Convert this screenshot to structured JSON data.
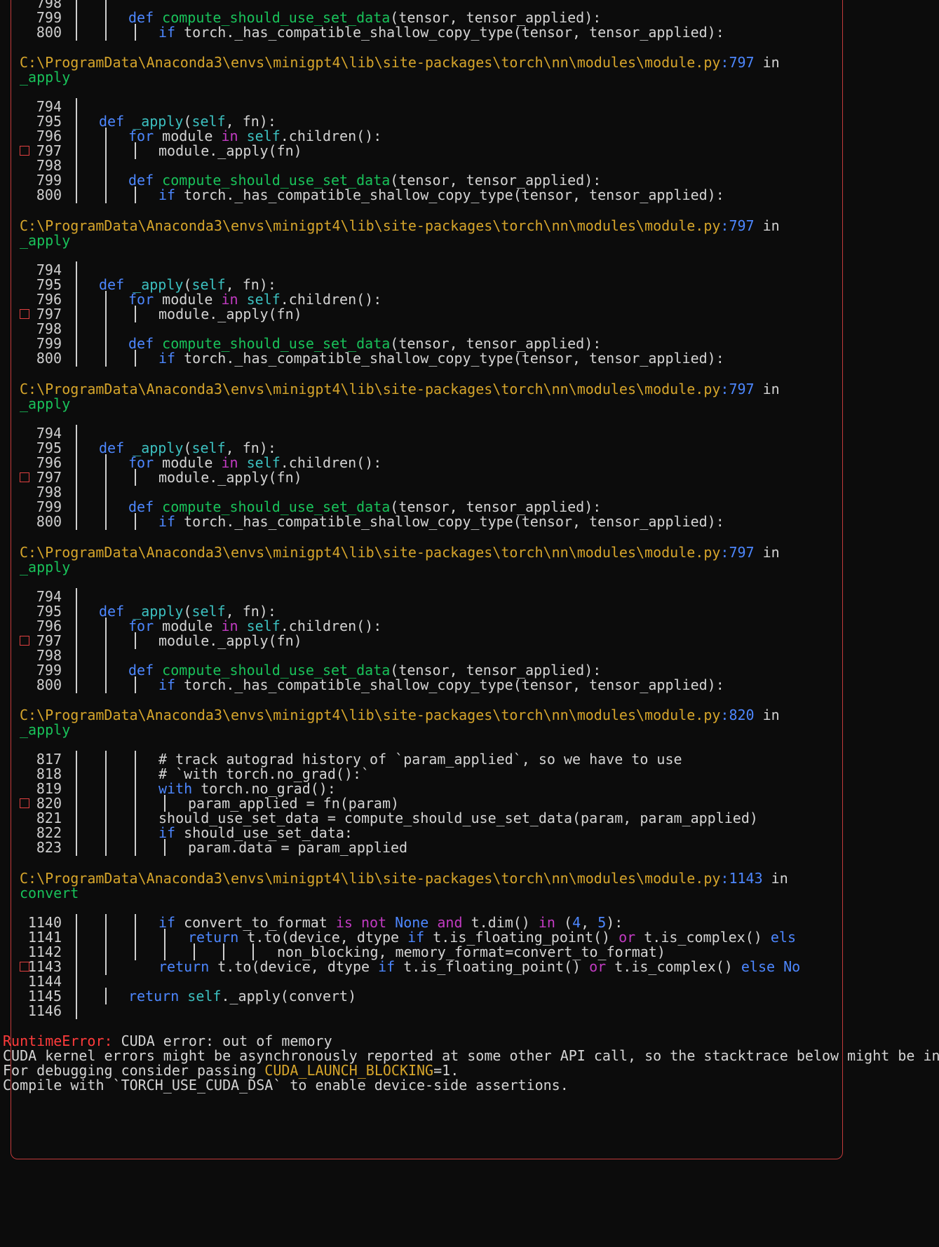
{
  "traceback": {
    "frames": [
      {
        "path": "C:\\ProgramData\\Anaconda3\\envs\\minigpt4\\lib\\site-packages\\torch\\nn\\modules\\module.py",
        "lineno": "797",
        "in": " in",
        "func": "_apply"
      },
      {
        "path": "C:\\ProgramData\\Anaconda3\\envs\\minigpt4\\lib\\site-packages\\torch\\nn\\modules\\module.py",
        "lineno": "797",
        "in": " in",
        "func": "_apply"
      },
      {
        "path": "C:\\ProgramData\\Anaconda3\\envs\\minigpt4\\lib\\site-packages\\torch\\nn\\modules\\module.py",
        "lineno": "797",
        "in": " in",
        "func": "_apply"
      },
      {
        "path": "C:\\ProgramData\\Anaconda3\\envs\\minigpt4\\lib\\site-packages\\torch\\nn\\modules\\module.py",
        "lineno": "797",
        "in": " in",
        "func": "_apply"
      },
      {
        "path": "C:\\ProgramData\\Anaconda3\\envs\\minigpt4\\lib\\site-packages\\torch\\nn\\modules\\module.py",
        "lineno": "820",
        "in": " in",
        "func": "_apply"
      },
      {
        "path": "C:\\ProgramData\\Anaconda3\\envs\\minigpt4\\lib\\site-packages\\torch\\nn\\modules\\module.py",
        "lineno": "1143",
        "in": " in",
        "func": "convert"
      }
    ],
    "code_797_block": [
      {
        "n": "794",
        "marked": false,
        "tokens": []
      },
      {
        "n": "795",
        "marked": false,
        "tokens": [
          [
            "b",
            "def "
          ],
          [
            "c",
            "_apply"
          ],
          [
            "w",
            "("
          ],
          [
            "c",
            "self"
          ],
          [
            "w",
            ", fn):"
          ]
        ]
      },
      {
        "n": "796",
        "marked": false,
        "tokens": [
          [
            "b",
            "for "
          ],
          [
            "w",
            "module "
          ],
          [
            "m",
            "in "
          ],
          [
            "c",
            "self"
          ],
          [
            "w",
            ".children():"
          ]
        ]
      },
      {
        "n": "797",
        "marked": true,
        "tokens": [
          [
            "w",
            "module._apply(fn)"
          ]
        ]
      },
      {
        "n": "798",
        "marked": false,
        "tokens": []
      },
      {
        "n": "799",
        "marked": false,
        "tokens": [
          [
            "b",
            "def "
          ],
          [
            "g",
            "compute_should_use_set_data"
          ],
          [
            "w",
            "(tensor, tensor_applied):"
          ]
        ]
      },
      {
        "n": "800",
        "marked": false,
        "tokens": [
          [
            "b",
            "if "
          ],
          [
            "w",
            "torch._has_compatible_shallow_copy_type(tensor, tensor_applied):"
          ]
        ]
      }
    ],
    "top_partial": [
      {
        "n": "798",
        "tokens": []
      },
      {
        "n": "799",
        "tokens": [
          [
            "b",
            "def "
          ],
          [
            "g",
            "compute_should_use_set_data"
          ],
          [
            "w",
            "(tensor, tensor_applied):"
          ]
        ]
      },
      {
        "n": "800",
        "tokens": [
          [
            "b",
            "if "
          ],
          [
            "w",
            "torch._has_compatible_shallow_copy_type(tensor, tensor_applied):"
          ]
        ]
      }
    ],
    "code_820_block": [
      {
        "n": "817",
        "marked": false,
        "tokens": [
          [
            "w",
            "# track autograd history of `param_applied`, so we have to use"
          ]
        ]
      },
      {
        "n": "818",
        "marked": false,
        "tokens": [
          [
            "w",
            "# `with torch.no_grad():`"
          ]
        ]
      },
      {
        "n": "819",
        "marked": false,
        "tokens": [
          [
            "b",
            "with "
          ],
          [
            "w",
            "torch.no_grad():"
          ]
        ]
      },
      {
        "n": "820",
        "marked": true,
        "tokens": [
          [
            "w",
            "param_applied = fn(param)"
          ]
        ]
      },
      {
        "n": "821",
        "marked": false,
        "tokens": [
          [
            "w",
            "should_use_set_data = compute_should_use_set_data(param, param_applied)"
          ]
        ]
      },
      {
        "n": "822",
        "marked": false,
        "tokens": [
          [
            "b",
            "if "
          ],
          [
            "w",
            "should_use_set_data:"
          ]
        ]
      },
      {
        "n": "823",
        "marked": false,
        "tokens": [
          [
            "w",
            "param.data = param_applied"
          ]
        ]
      }
    ],
    "code_1143_block": [
      {
        "n": "1140",
        "marked": false,
        "tokens": [
          [
            "b",
            "if "
          ],
          [
            "w",
            "convert_to_format "
          ],
          [
            "m",
            "is not "
          ],
          [
            "b",
            "None "
          ],
          [
            "m",
            "and "
          ],
          [
            "w",
            "t.dim() "
          ],
          [
            "m",
            "in "
          ],
          [
            "w",
            "("
          ],
          [
            "b",
            "4"
          ],
          [
            "w",
            ", "
          ],
          [
            "b",
            "5"
          ],
          [
            "w",
            "):"
          ]
        ]
      },
      {
        "n": "1141",
        "marked": false,
        "tokens": [
          [
            "b",
            "return "
          ],
          [
            "w",
            "t.to(device, dtype "
          ],
          [
            "b",
            "if "
          ],
          [
            "w",
            "t.is_floating_point() "
          ],
          [
            "m",
            "or "
          ],
          [
            "w",
            "t.is_complex() "
          ],
          [
            "b",
            "els"
          ]
        ]
      },
      {
        "n": "1142",
        "marked": false,
        "tokens": [
          [
            "w",
            "non_blocking, memory_format=convert_to_format)"
          ]
        ]
      },
      {
        "n": "1143",
        "marked": true,
        "tokens": [
          [
            "b",
            "return "
          ],
          [
            "w",
            "t.to(device, dtype "
          ],
          [
            "b",
            "if "
          ],
          [
            "w",
            "t.is_floating_point() "
          ],
          [
            "m",
            "or "
          ],
          [
            "w",
            "t.is_complex() "
          ],
          [
            "b",
            "else No"
          ]
        ]
      },
      {
        "n": "1144",
        "marked": false,
        "tokens": []
      },
      {
        "n": "1145",
        "marked": false,
        "tokens": [
          [
            "b",
            "return "
          ],
          [
            "c",
            "self"
          ],
          [
            "w",
            "._apply(convert)"
          ]
        ]
      },
      {
        "n": "1146",
        "marked": false,
        "tokens": []
      }
    ]
  },
  "error": {
    "type": "RuntimeError:",
    "message": " CUDA error: out of memory",
    "line2": "CUDA kernel errors might be asynchronously reported at some other API call, so the stacktrace below might be inc",
    "line3_pre": "For debugging consider passing ",
    "line3_var": "CUDA_LAUNCH_BLOCKING",
    "line3_post": "=1.",
    "line4": "Compile with `TORCH_USE_CUDA_DSA` to enable device-side assertions."
  },
  "colors": {
    "path": "#d6a52b",
    "lineno": "#4d87ff",
    "keyword": "#4d87ff",
    "funcname": "#19c25a",
    "operator": "#c23bc2",
    "builtin": "#3cc0c0",
    "error": "#ff3b3b",
    "border": "#c23b3b"
  }
}
